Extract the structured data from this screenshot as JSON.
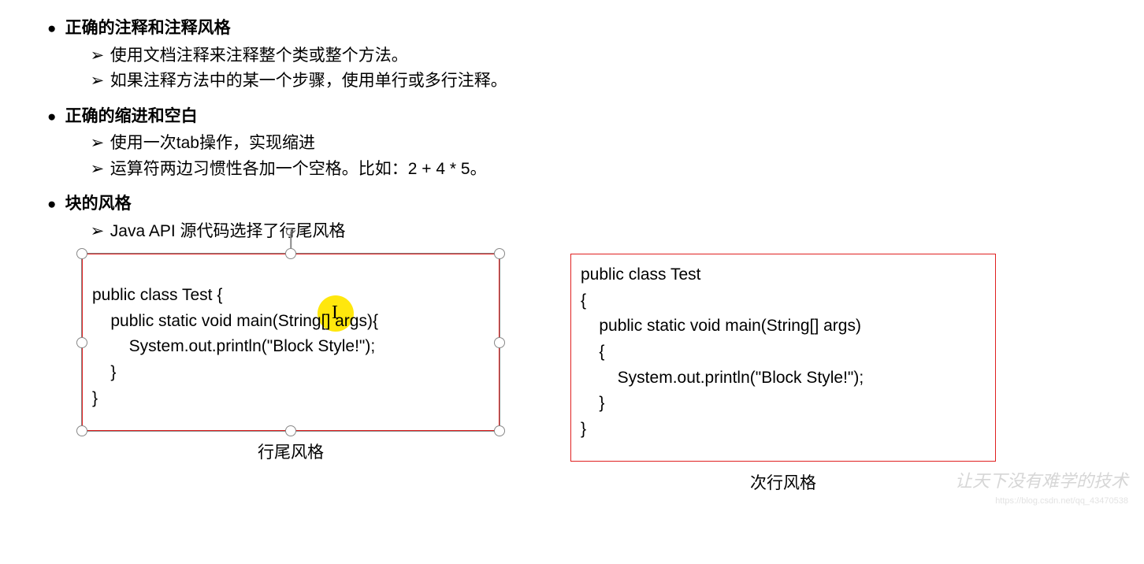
{
  "sections": [
    {
      "title": "正确的注释和注释风格",
      "items": [
        "使用文档注释来注释整个类或整个方法。",
        "如果注释方法中的某一个步骤，使用单行或多行注释。"
      ]
    },
    {
      "title": "正确的缩进和空白",
      "items": [
        "使用一次tab操作，实现缩进",
        "运算符两边习惯性各加一个空格。比如：2 + 4 * 5。"
      ]
    },
    {
      "title": "块的风格",
      "items": [
        "Java API 源代码选择了行尾风格"
      ]
    }
  ],
  "codeLeft": "public class Test {\n    public static void main(String[] args){\n        System.out.println(\"Block Style!\");\n    }\n}",
  "codeRight": "public class Test\n{\n    public static void main(String[] args)\n    {\n        System.out.println(\"Block Style!\");\n    }\n}",
  "captionLeft": "行尾风格",
  "captionRight": "次行风格",
  "cursorGlyph": "I",
  "rotateGlyph": "⟳",
  "watermark": {
    "main": "让天下没有难学的技术",
    "sub": "https://blog.csdn.net/qq_43470538"
  }
}
